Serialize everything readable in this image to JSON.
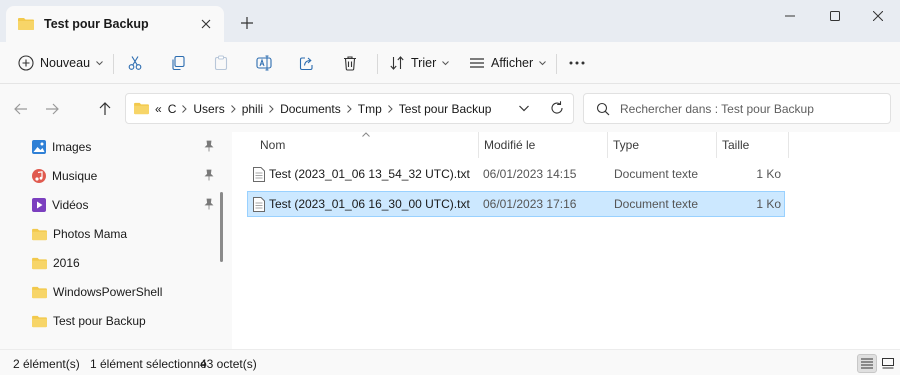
{
  "tab": {
    "title": "Test pour Backup"
  },
  "toolbar": {
    "new_label": "Nouveau",
    "sort_label": "Trier",
    "view_label": "Afficher"
  },
  "address": {
    "crumbs": [
      "C",
      "Users",
      "phili",
      "Documents",
      "Tmp",
      "Test pour Backup"
    ]
  },
  "search": {
    "placeholder": "Rechercher dans : Test pour Backup"
  },
  "sidebar": {
    "items": [
      {
        "label": "Images",
        "icon": "images-icon",
        "pinned": true
      },
      {
        "label": "Musique",
        "icon": "music-icon",
        "pinned": true
      },
      {
        "label": "Vidéos",
        "icon": "videos-icon",
        "pinned": true
      },
      {
        "label": "Photos Mama",
        "icon": "folder-icon",
        "pinned": false
      },
      {
        "label": "2016",
        "icon": "folder-icon",
        "pinned": false
      },
      {
        "label": "WindowsPowerShell",
        "icon": "folder-icon",
        "pinned": false
      },
      {
        "label": "Test pour Backup",
        "icon": "folder-icon",
        "pinned": false
      }
    ]
  },
  "columns": {
    "name": "Nom",
    "modified": "Modifié le",
    "type": "Type",
    "size": "Taille"
  },
  "files": [
    {
      "name": "Test (2023_01_06 13_54_32 UTC).txt",
      "modified": "06/01/2023 14:15",
      "type": "Document texte",
      "size": "1 Ko",
      "selected": false
    },
    {
      "name": "Test (2023_01_06 16_30_00 UTC).txt",
      "modified": "06/01/2023 17:16",
      "type": "Document texte",
      "size": "1 Ko",
      "selected": true
    }
  ],
  "status": {
    "count": "2 élément(s)",
    "selection": "1 élément sélectionné",
    "size": "43 octet(s)"
  },
  "colors": {
    "accent": "#0067c0",
    "folder": "#f2c94c",
    "selection": "#cce8ff"
  }
}
